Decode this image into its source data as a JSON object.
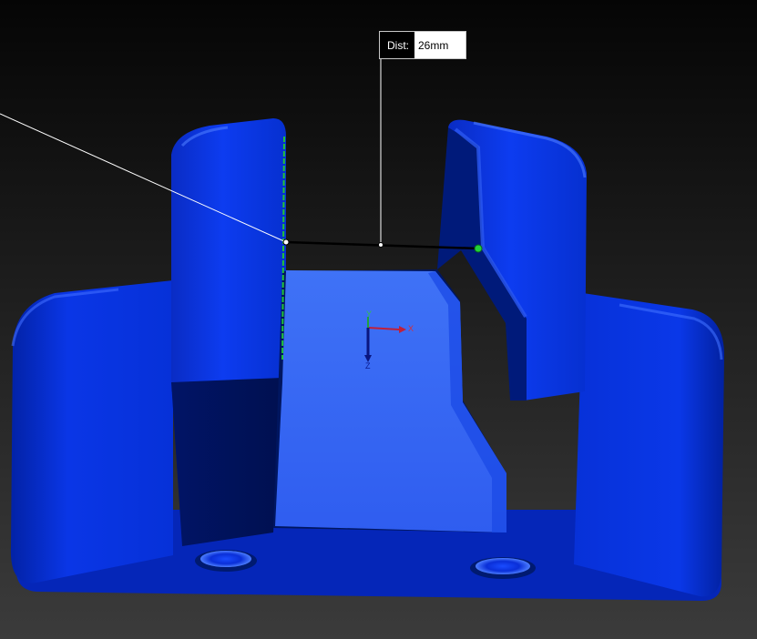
{
  "measurement": {
    "label": "Dist:",
    "value": "26mm"
  },
  "triad": {
    "x_label": "X",
    "y_label": "Y",
    "z_label": "Z"
  },
  "colors": {
    "background_top": "#050505",
    "background_bottom": "#3a3a3a",
    "part_blue": "#0a32e0",
    "part_dark": "#001a6e",
    "floor_light": "#3a6cf2",
    "edge_highlight": "#22c33a",
    "dimension_line": "#000000",
    "leader_line": "#ffffff"
  }
}
